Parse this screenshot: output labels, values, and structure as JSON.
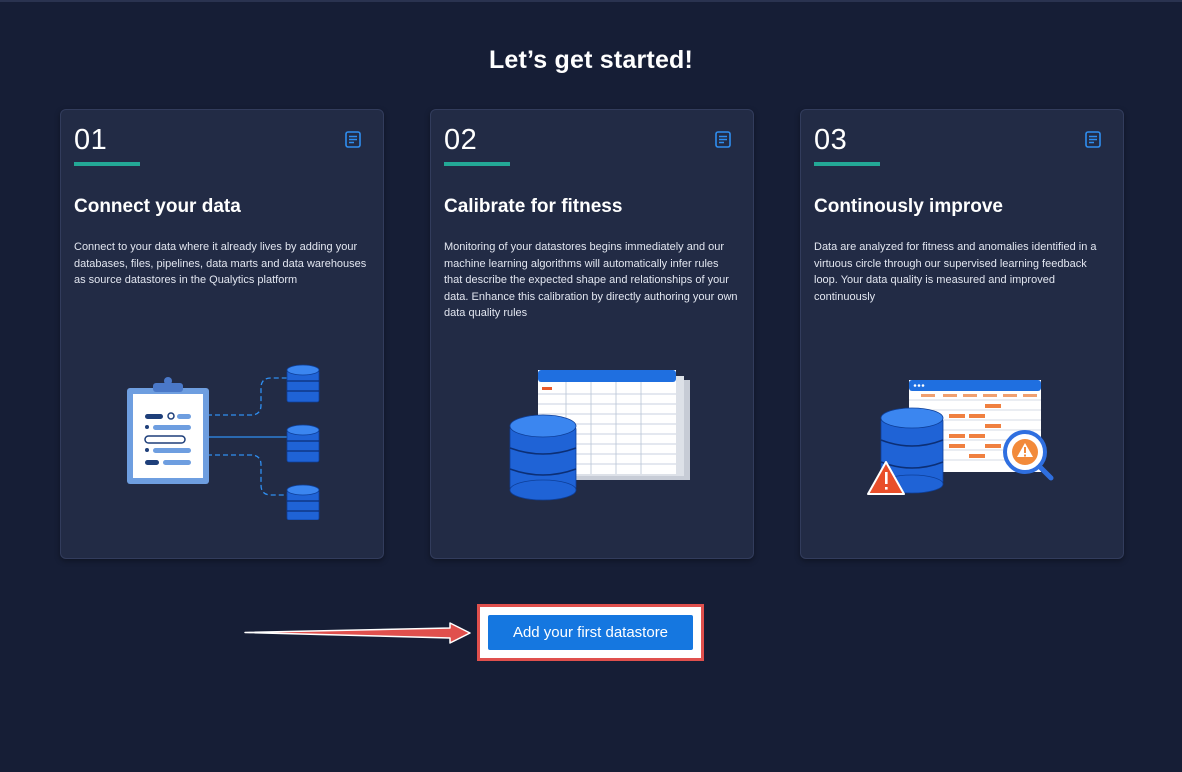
{
  "page": {
    "title": "Let’s get started!",
    "cta_label": "Add your first datastore"
  },
  "colors": {
    "background": "#161e36",
    "card": "#222b45",
    "accent_bar": "#23a896",
    "primary": "#1577e0",
    "highlight": "#e0504d"
  },
  "cards": [
    {
      "number": "01",
      "heading": "Connect your data",
      "description": "Connect to your data where it already lives by adding your databases, files, pipelines, data marts and data warehouses as source datastores in the Qualytics platform",
      "icon": "document-icon",
      "illustration": "clipboard-to-databases"
    },
    {
      "number": "02",
      "heading": "Calibrate for fitness",
      "description": "Monitoring of your datastores begins immediately and our machine learning algorithms will automatically infer rules that describe the expected shape and relationships of your data. Enhance this calibration by directly authoring your own data quality rules",
      "icon": "document-icon",
      "illustration": "database-with-spreadsheets"
    },
    {
      "number": "03",
      "heading": "Continously improve",
      "description": "Data are analyzed for fitness and anomalies identified in a virtuous circle through our supervised learning feedback loop. Your data quality is measured and improved continuously",
      "icon": "document-icon",
      "illustration": "database-anomaly-search"
    }
  ]
}
